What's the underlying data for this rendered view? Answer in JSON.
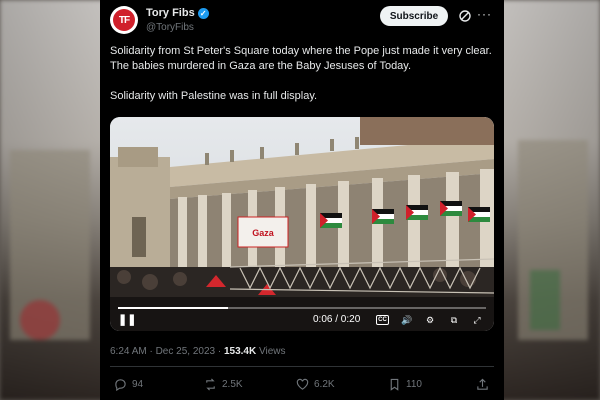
{
  "post": {
    "author_name": "Tory Fibs",
    "handle": "@ToryFibs",
    "avatar_text": "TF",
    "verified_glyph": "✓",
    "subscribe_label": "Subscribe",
    "more_label": "···",
    "text_line1": "Solidarity from St Peter's Square today where the Pope just made it very clear. The babies murdered in Gaza are the Baby Jesuses of Today.",
    "text_line2": "Solidarity with Palestine was in full display."
  },
  "video": {
    "time_display": "0:06 / 0:20",
    "progress_fraction": 0.3,
    "banner_text": "Gaza",
    "play_glyph": "❚❚",
    "cc_label": "CC",
    "volume_glyph": "🔊",
    "settings_glyph": "⚙",
    "pip_glyph": "⧉",
    "fullscreen_glyph": "⤢"
  },
  "meta": {
    "timestamp": "6:24 AM · Dec 25, 2023 · ",
    "views_count": "153.4K",
    "views_label": " Views"
  },
  "actions": {
    "replies": "94",
    "reposts": "2.5K",
    "likes": "6.2K",
    "bookmarks": "110"
  },
  "icons": [
    "verified-icon",
    "grok-icon",
    "more-icon",
    "play-icon",
    "captions-icon",
    "volume-icon",
    "settings-icon",
    "pip-icon",
    "fullscreen-icon",
    "reply-icon",
    "repost-icon",
    "like-icon",
    "bookmark-icon",
    "share-icon"
  ],
  "colors": {
    "accent": "#1d9bf0",
    "background": "#000000",
    "muted": "#71767b",
    "text": "#e7e9ea",
    "brand_red": "#d0202b"
  }
}
